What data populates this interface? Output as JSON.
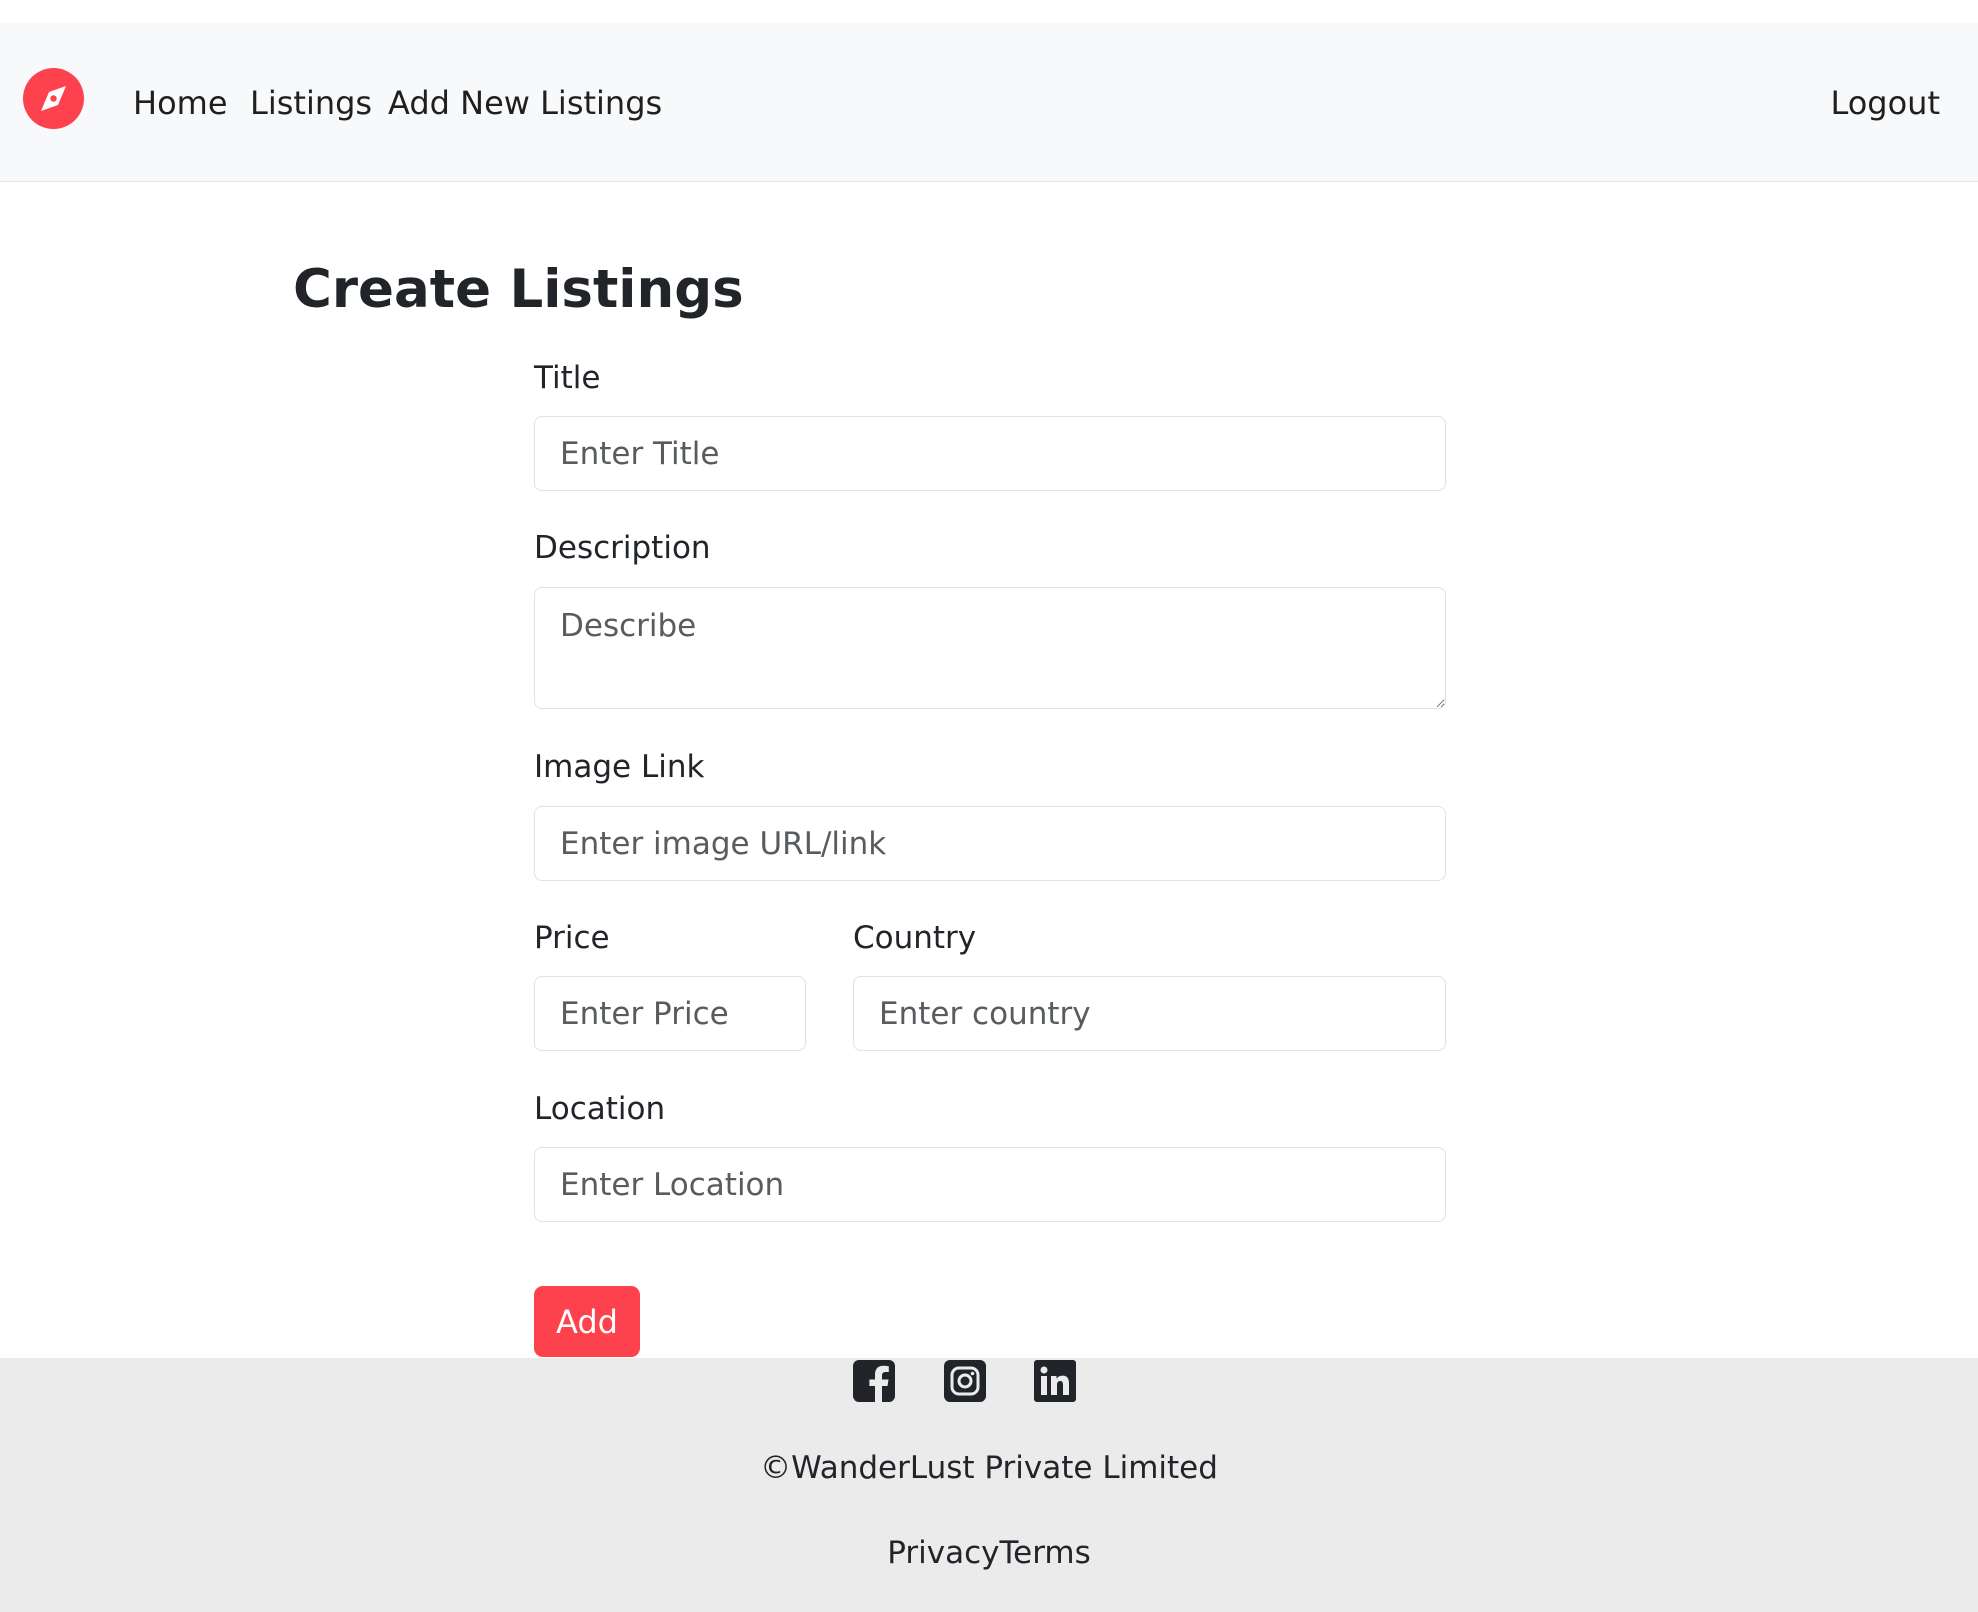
{
  "colors": {
    "brand": "#fe424d",
    "navbar_bg": "#f8f9fa",
    "footer_bg": "#ebebeb",
    "icon_dark": "#212529"
  },
  "navbar": {
    "logo_icon": "compass-icon",
    "links": [
      "Home",
      "Listings",
      "Add New Listings"
    ],
    "logout_label": "Logout"
  },
  "form": {
    "heading": "Create Listings",
    "title": {
      "label": "Title",
      "placeholder": "Enter Title",
      "value": ""
    },
    "description": {
      "label": "Description",
      "placeholder": "Describe",
      "value": ""
    },
    "image": {
      "label": "Image Link",
      "placeholder": "Enter image URL/link",
      "value": ""
    },
    "price": {
      "label": "Price",
      "placeholder": "Enter Price",
      "value": ""
    },
    "country": {
      "label": "Country",
      "placeholder": "Enter country",
      "value": ""
    },
    "location": {
      "label": "Location",
      "placeholder": "Enter Location",
      "value": ""
    },
    "submit_label": "Add"
  },
  "footer": {
    "social_icons": [
      "facebook-icon",
      "instagram-icon",
      "linkedin-icon"
    ],
    "copyright": "©WanderLust Private Limited",
    "links": [
      "Privacy",
      "Terms"
    ]
  }
}
